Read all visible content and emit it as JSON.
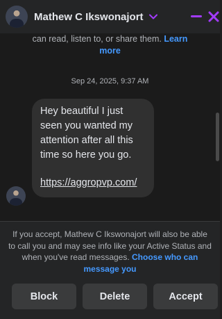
{
  "header": {
    "contact_name": "Mathew C Ikswonajort",
    "accent_color": "#a33bff",
    "icons": [
      "chevron-down-icon",
      "minimize-icon",
      "close-icon"
    ]
  },
  "conversation": {
    "policy_text": "can read, listen to, or share them.",
    "policy_link": "Learn more",
    "timestamp": "Sep 24, 2025, 9:37 AM",
    "message": {
      "text": "Hey beautiful I just seen you wanted my attention after all this time so here you go.",
      "link": "https://aggropvp.com/"
    }
  },
  "request": {
    "notice": "If you accept, Mathew C Ikswonajort will also be able to call you and may see info like your Active Status and when you've read messages.",
    "choose_link": "Choose who can message you",
    "buttons": {
      "block": "Block",
      "delete": "Delete",
      "accept": "Accept"
    }
  },
  "colors": {
    "background": "#1b1b1b",
    "panel": "#242526",
    "bubble": "#303030",
    "link": "#4599ff"
  }
}
